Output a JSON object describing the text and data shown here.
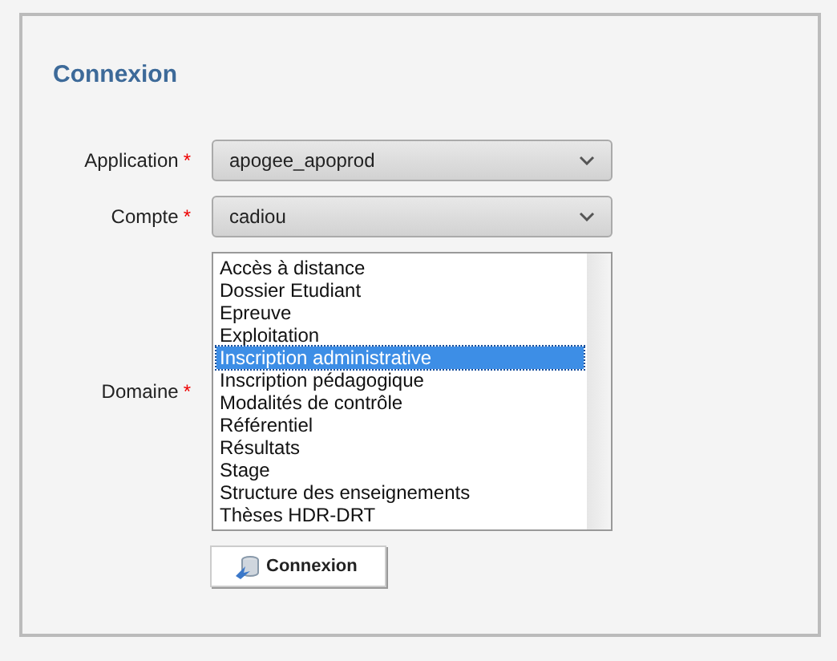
{
  "title": "Connexion",
  "fields": [
    {
      "label": "Application",
      "required": true,
      "kind": "select",
      "value": "apogee_apoprod"
    },
    {
      "label": "Compte",
      "required": true,
      "kind": "select",
      "value": "cadiou"
    },
    {
      "label": "Domaine",
      "required": true,
      "kind": "list",
      "options": [
        {
          "label": "Accès à distance",
          "selected": false
        },
        {
          "label": "Dossier Etudiant",
          "selected": false
        },
        {
          "label": "Epreuve",
          "selected": false
        },
        {
          "label": "Exploitation",
          "selected": false
        },
        {
          "label": "Inscription administrative",
          "selected": true
        },
        {
          "label": "Inscription pédagogique",
          "selected": false
        },
        {
          "label": "Modalités de contrôle",
          "selected": false
        },
        {
          "label": "Référentiel",
          "selected": false
        },
        {
          "label": "Résultats",
          "selected": false
        },
        {
          "label": "Stage",
          "selected": false
        },
        {
          "label": "Structure des enseignements",
          "selected": false
        },
        {
          "label": "Thèses HDR-DRT",
          "selected": false
        }
      ]
    }
  ],
  "button": "Connexion",
  "required_mark": "*"
}
